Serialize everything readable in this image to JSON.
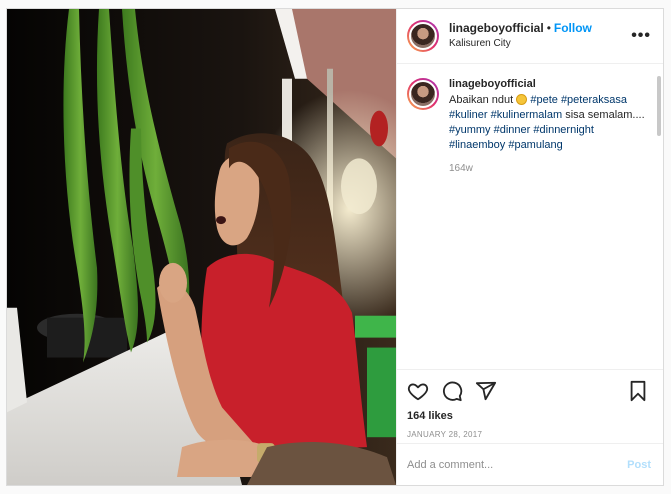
{
  "post": {
    "username": "linageboyofficial",
    "dot": "•",
    "follow_label": "Follow",
    "location": "Kalisuren City",
    "more_icon": "more-options-icon",
    "more_glyph": "•••"
  },
  "caption": {
    "username": "linageboyofficial",
    "text_start": "Abaikan ndut ",
    "emoji_name": "grinning-face-emoji",
    "hashtags_line": [
      "#pete",
      "#peteraksasa",
      "#kuliner",
      "#kulinermalam"
    ],
    "middle_text": "sisa semalam....",
    "hashtags_tail": [
      "#yummy",
      "#dinner",
      "#dinnernight",
      "#linaemboy",
      "#pamulang"
    ],
    "time_ago": "164w"
  },
  "actions": {
    "like_icon": "heart-icon",
    "comment_icon": "comment-icon",
    "share_icon": "share-icon",
    "save_icon": "bookmark-icon",
    "likes_text": "164 likes",
    "date": "JANUARY 28, 2017"
  },
  "comment_box": {
    "placeholder": "Add a comment...",
    "post_label": "Post"
  },
  "colors": {
    "follow_blue": "#0095f6",
    "hashtag": "#00376b",
    "post_disabled": "#b2dffc"
  }
}
